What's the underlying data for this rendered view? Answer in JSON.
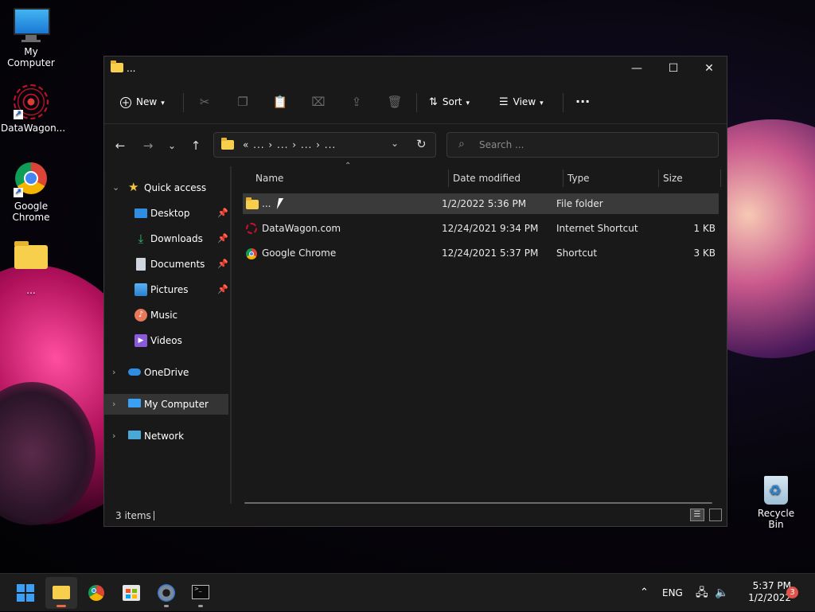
{
  "desktop": {
    "icons": [
      {
        "label": "My Computer",
        "icon": "monitor-icon"
      },
      {
        "label": "DataWagon...",
        "icon": "datawagon-icon"
      },
      {
        "label": "Google Chrome",
        "icon": "chrome-icon"
      },
      {
        "label": "...",
        "icon": "folder-icon"
      }
    ],
    "recycle_bin": "Recycle Bin"
  },
  "window": {
    "title": "...",
    "controls": {
      "minimize": "—",
      "maximize": "☐",
      "close": "✕"
    }
  },
  "toolbar": {
    "new_label": "New",
    "sort_label": "Sort",
    "view_label": "View",
    "more": "···"
  },
  "nav": {
    "back": "←",
    "forward": "→",
    "recent": "⌄",
    "up": "↑",
    "breadcrumb": "«  ...  ›  ...  ›  ...  ›  ...",
    "refresh": "↻",
    "dropdown": "⌄"
  },
  "search": {
    "placeholder": "Search ..."
  },
  "sidebar": {
    "quick_access": "Quick access",
    "items": [
      {
        "label": "Desktop",
        "icon": "desktop-icon",
        "pinned": true
      },
      {
        "label": "Downloads",
        "icon": "downloads-icon",
        "pinned": true
      },
      {
        "label": "Documents",
        "icon": "documents-icon",
        "pinned": true
      },
      {
        "label": "Pictures",
        "icon": "pictures-icon",
        "pinned": true
      },
      {
        "label": "Music",
        "icon": "music-icon",
        "pinned": false
      },
      {
        "label": "Videos",
        "icon": "videos-icon",
        "pinned": false
      }
    ],
    "onedrive": "OneDrive",
    "my_computer": "My Computer",
    "network": "Network"
  },
  "columns": {
    "name": "Name",
    "date": "Date modified",
    "type": "Type",
    "size": "Size"
  },
  "files": [
    {
      "name": "...",
      "date": "1/2/2022 5:36 PM",
      "type": "File folder",
      "size": ""
    },
    {
      "name": "DataWagon.com",
      "date": "12/24/2021 9:34 PM",
      "type": "Internet Shortcut",
      "size": "1 KB"
    },
    {
      "name": "Google Chrome",
      "date": "12/24/2021 5:37 PM",
      "type": "Shortcut",
      "size": "3 KB"
    }
  ],
  "status": {
    "items": "3 items"
  },
  "taskbar": {
    "tray_language": "ENG",
    "time": "5:37 PM",
    "date": "1/2/2022",
    "notifications": "3"
  }
}
